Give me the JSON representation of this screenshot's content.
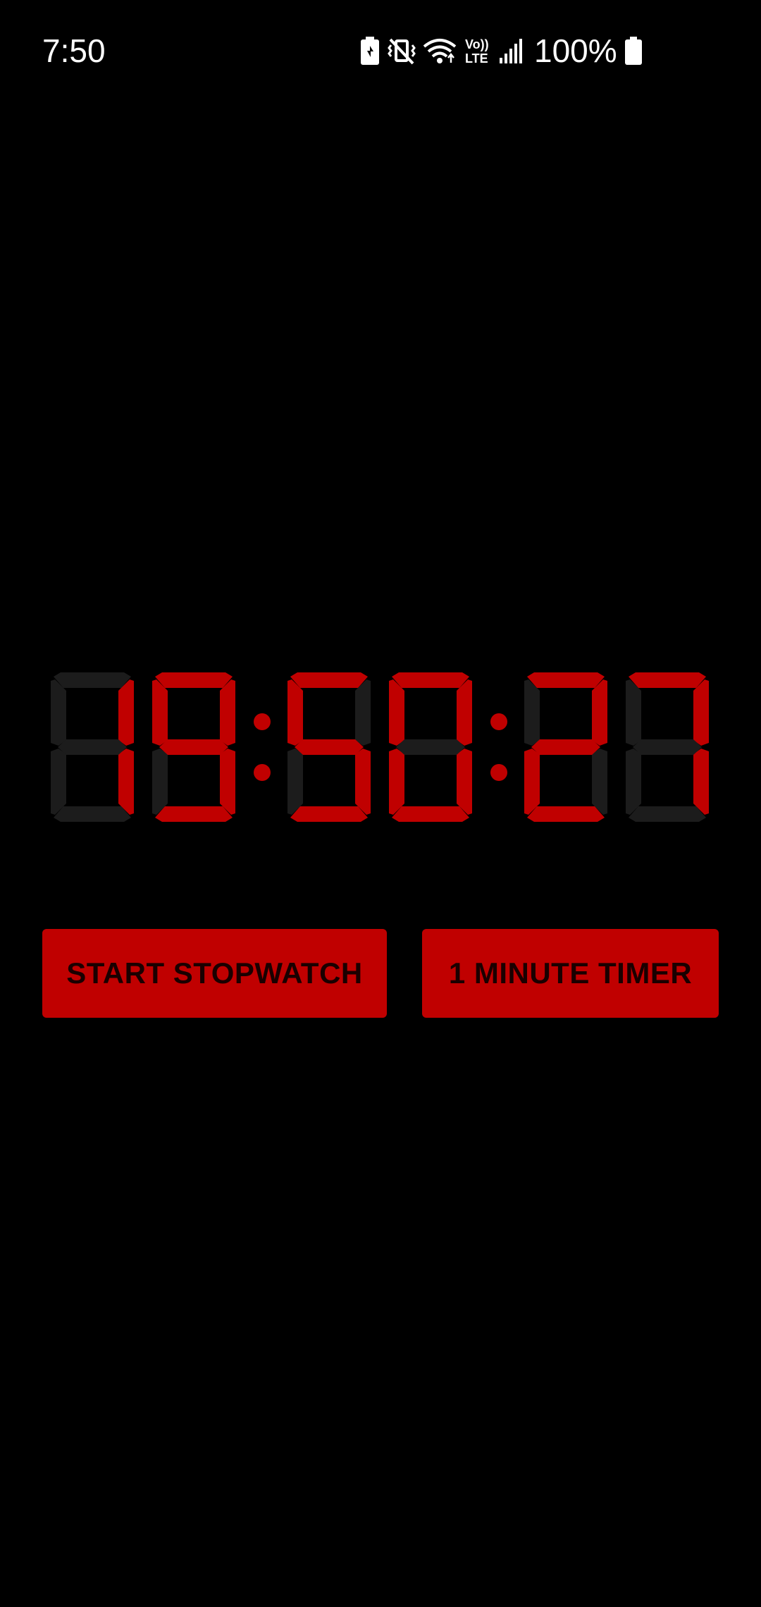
{
  "status_bar": {
    "time": "7:50",
    "volte_top": "Vo))",
    "volte_bottom": "LTE",
    "battery_percent": "100%",
    "icons": [
      "battery-saver-icon",
      "vibrate-mute-icon",
      "wifi-icon",
      "volte-icon",
      "signal-icon",
      "battery-icon"
    ]
  },
  "clock": {
    "display_time": "19:50:27",
    "hours": "19",
    "minutes": "50",
    "seconds": "27"
  },
  "buttons": {
    "start_stopwatch": "START STOPWATCH",
    "one_minute_timer": "1 MINUTE TIMER"
  },
  "colors": {
    "background": "#000000",
    "segment_on": "#c00000",
    "segment_off": "#1c1c1c",
    "button_bg": "#c00000",
    "button_text": "#1a0000"
  }
}
